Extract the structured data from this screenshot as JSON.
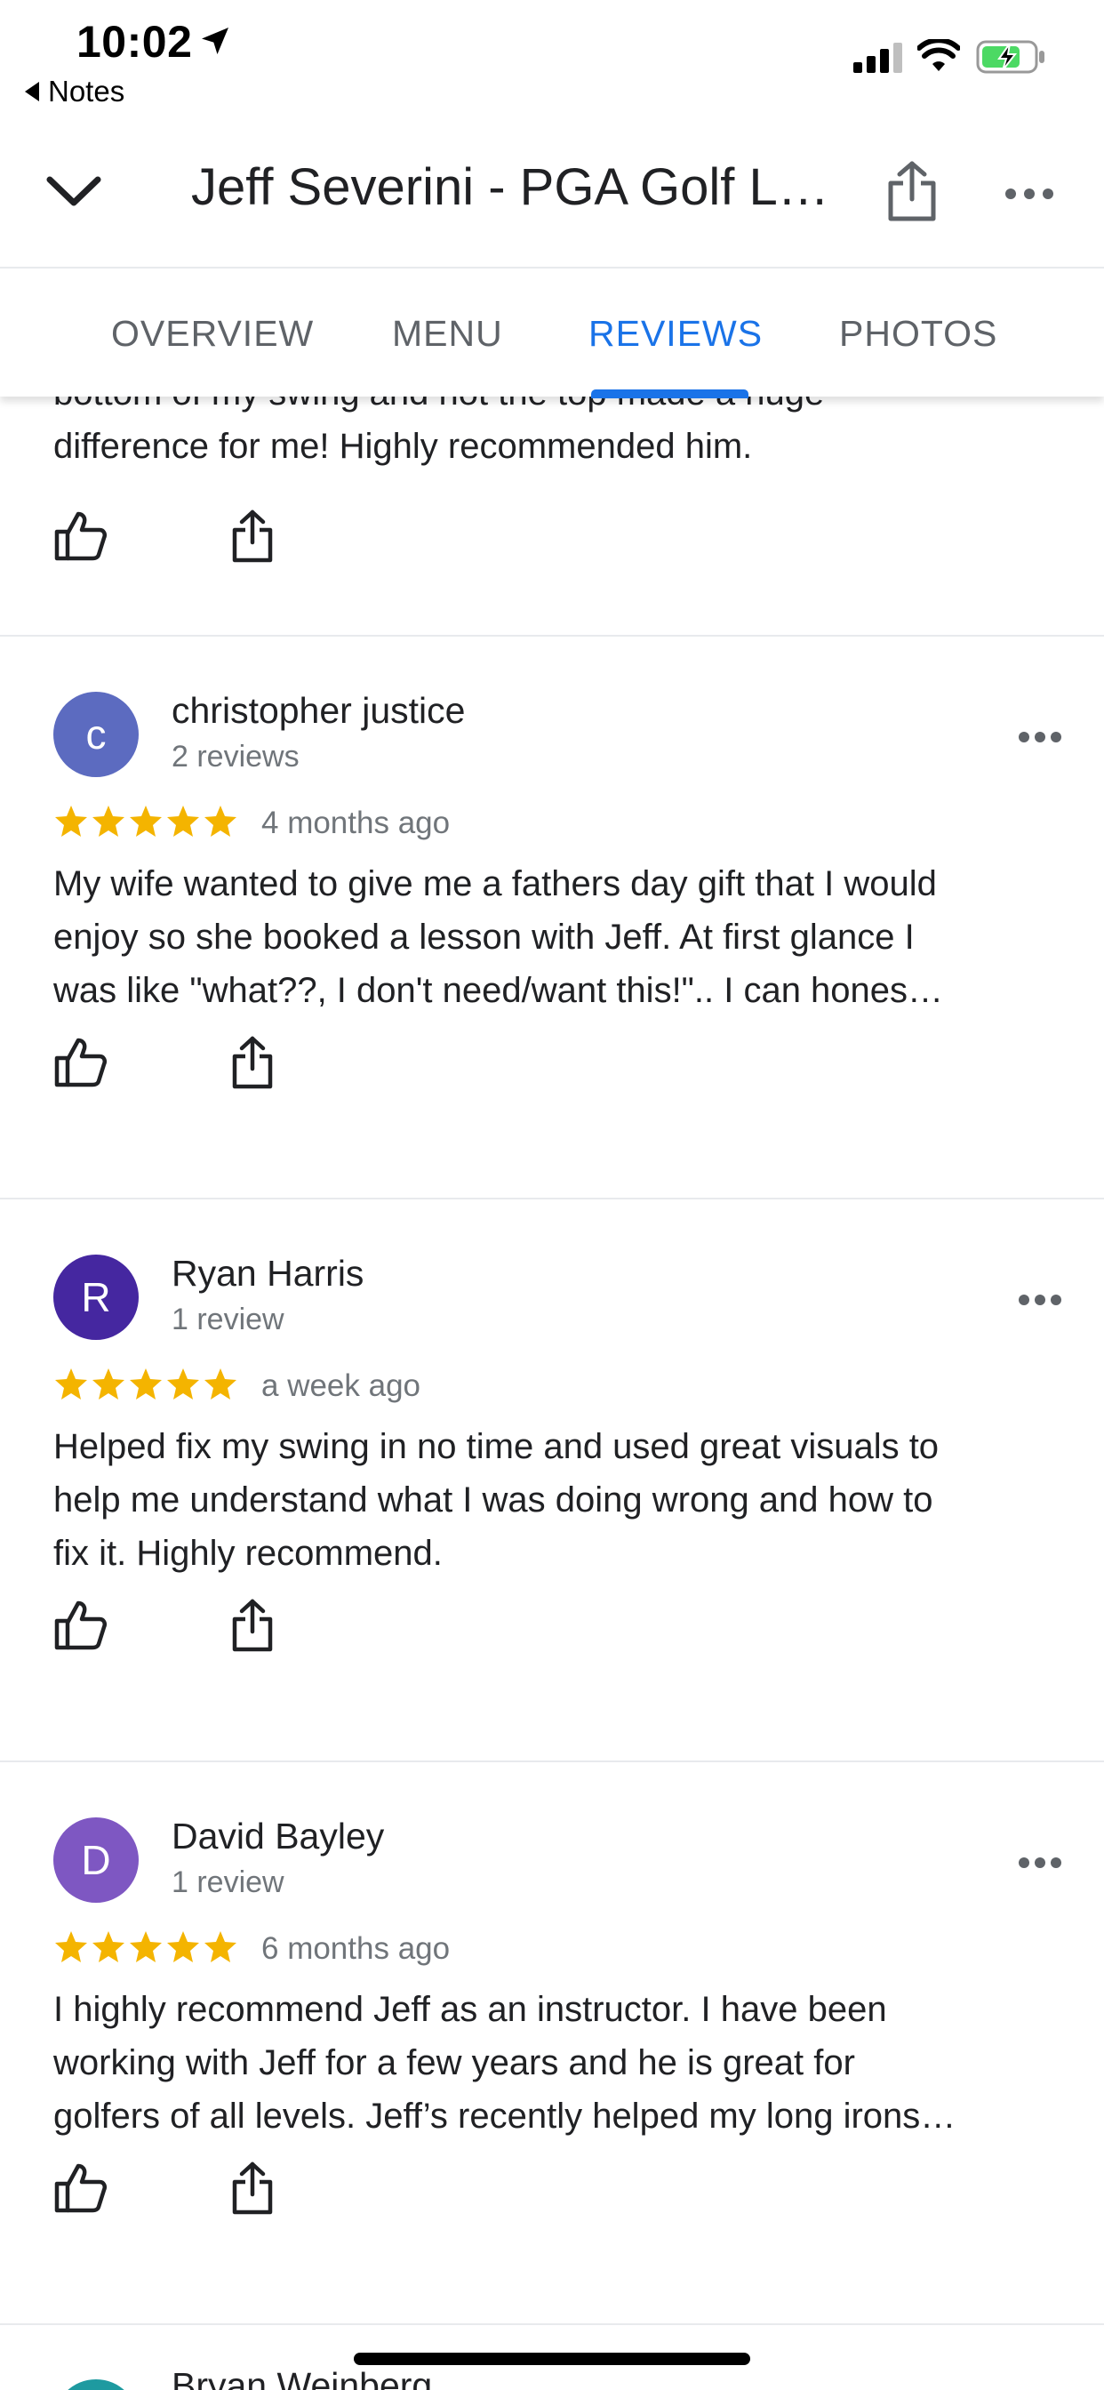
{
  "status": {
    "time": "10:02",
    "back_app": "Notes"
  },
  "header": {
    "title": "Jeff Severini - PGA Golf Lessons"
  },
  "tabs": [
    {
      "label": "OVERVIEW",
      "active": false
    },
    {
      "label": "MENU",
      "active": false
    },
    {
      "label": "REVIEWS",
      "active": true
    },
    {
      "label": "PHOTOS",
      "active": false
    }
  ],
  "partial_review": {
    "line1": "bottom of my swing and not the top made a huge",
    "line2": "difference for me! Highly recommended him."
  },
  "reviews": [
    {
      "initial": "c",
      "name": "christopher justice",
      "count": "2 reviews",
      "rating": 5,
      "time": "4 months ago",
      "avatar_color": "#5c6bc0",
      "lines": [
        "My wife wanted to give me a fathers day gift that I would",
        "enjoy so she booked a lesson with Jeff. At first glance I",
        "was like \"what??, I don't need/want this!\"..    I can hones…"
      ]
    },
    {
      "initial": "R",
      "name": "Ryan Harris",
      "count": "1 review",
      "rating": 5,
      "time": "a week ago",
      "avatar_color": "#4527a0",
      "lines": [
        "Helped fix my swing in no time and used great visuals to",
        "help me understand what I was doing wrong and how to",
        "fix it. Highly recommend."
      ]
    },
    {
      "initial": "D",
      "name": "David Bayley",
      "count": "1 review",
      "rating": 5,
      "time": "6 months ago",
      "avatar_color": "#7e57c2",
      "lines": [
        "I highly recommend Jeff as an instructor.  I have been",
        "working with Jeff for a few years and he is great for",
        "golfers of all levels.  Jeff’s recently helped my long irons…"
      ]
    }
  ],
  "next_review": {
    "name": "Bryan Weinberg"
  },
  "colors": {
    "accent": "#1a73e8",
    "star": "#f4b400",
    "text": "#202124",
    "secondary": "#70757a",
    "next_avatar": "#1e9aa0"
  }
}
